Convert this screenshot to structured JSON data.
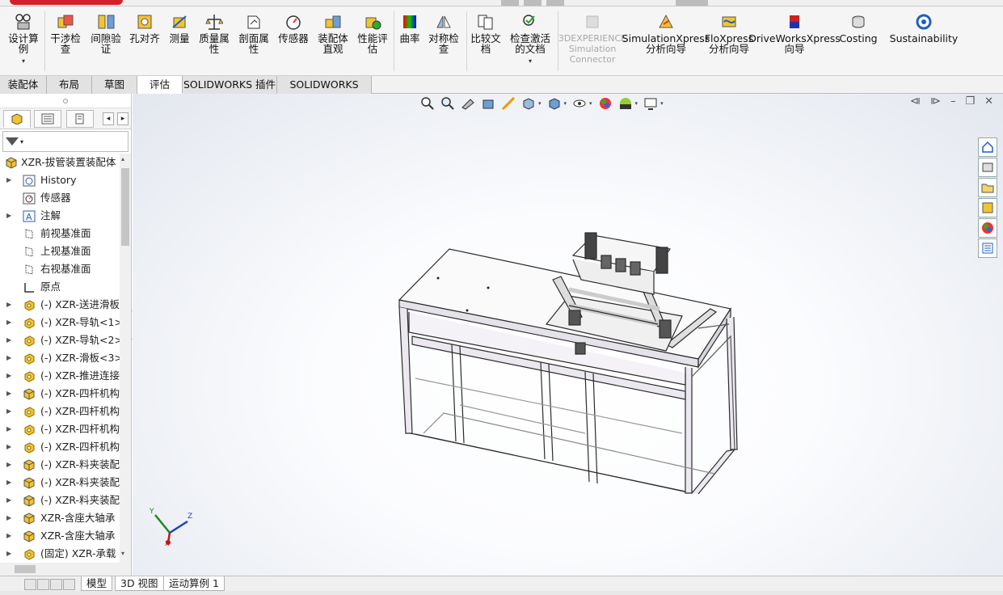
{
  "ribbon": {
    "buttons": [
      {
        "label": "设计算例",
        "dim": false
      },
      {
        "label": "干涉检查",
        "dim": false
      },
      {
        "label": "间隙验证",
        "dim": false
      },
      {
        "label": "孔对齐",
        "dim": false
      },
      {
        "label": "测量",
        "dim": false
      },
      {
        "label": "质量属性",
        "dim": false
      },
      {
        "label": "剖面属性",
        "dim": false
      },
      {
        "label": "传感器",
        "dim": false
      },
      {
        "label": "装配体直观",
        "dim": false
      },
      {
        "label": "性能评估",
        "dim": false
      },
      {
        "label": "曲率",
        "dim": false
      },
      {
        "label": "对称检查",
        "dim": false
      },
      {
        "label": "比较文档",
        "dim": false
      },
      {
        "label": "检查激活的文档",
        "dim": false
      },
      {
        "label": "3DEXPERIENCE Simulation Connector",
        "dim": true
      },
      {
        "label": "SimulationXpress 分析向导",
        "dim": false
      },
      {
        "label": "FloXpress 分析向导",
        "dim": false
      },
      {
        "label": "DriveWorksXpress 向导",
        "dim": false
      },
      {
        "label": "Costing",
        "dim": false
      },
      {
        "label": "Sustainability",
        "dim": false
      }
    ]
  },
  "command_tabs": [
    "装配体",
    "布局",
    "草图",
    "评估",
    "SOLIDWORKS 插件",
    "SOLIDWORKS MBD"
  ],
  "active_tab": "评估",
  "tree": {
    "root": "XZR-拔管装置装配体",
    "items": [
      {
        "label": "History",
        "expand": true,
        "icon": "history-icon"
      },
      {
        "label": "传感器",
        "expand": false,
        "icon": "sensor-icon"
      },
      {
        "label": "注解",
        "expand": true,
        "icon": "annotation-icon"
      },
      {
        "label": "前视基准面",
        "expand": false,
        "icon": "plane-icon"
      },
      {
        "label": "上视基准面",
        "expand": false,
        "icon": "plane-icon"
      },
      {
        "label": "右视基准面",
        "expand": false,
        "icon": "plane-icon"
      },
      {
        "label": "原点",
        "expand": false,
        "icon": "origin-icon"
      },
      {
        "label": "(-) XZR-送进滑板<",
        "expand": true,
        "icon": "part-icon"
      },
      {
        "label": "(-) XZR-导轨<1>",
        "expand": true,
        "icon": "part-icon"
      },
      {
        "label": "(-) XZR-导轨<2>",
        "expand": true,
        "icon": "part-icon"
      },
      {
        "label": "(-) XZR-滑板<3>",
        "expand": true,
        "icon": "part-icon"
      },
      {
        "label": "(-) XZR-推进连接",
        "expand": true,
        "icon": "part-icon"
      },
      {
        "label": "(-) XZR-四杆机构",
        "expand": true,
        "icon": "assembly-icon"
      },
      {
        "label": "(-) XZR-四杆机构",
        "expand": true,
        "icon": "part-icon"
      },
      {
        "label": "(-) XZR-四杆机构",
        "expand": true,
        "icon": "part-icon"
      },
      {
        "label": "(-) XZR-四杆机构",
        "expand": true,
        "icon": "part-icon"
      },
      {
        "label": "(-) XZR-料夹装配",
        "expand": true,
        "icon": "assembly-icon"
      },
      {
        "label": "(-) XZR-料夹装配",
        "expand": true,
        "icon": "assembly-icon"
      },
      {
        "label": "(-) XZR-料夹装配",
        "expand": true,
        "icon": "assembly-icon"
      },
      {
        "label": "XZR-含座大轴承",
        "expand": true,
        "icon": "assembly-icon"
      },
      {
        "label": "XZR-含座大轴承",
        "expand": true,
        "icon": "assembly-icon"
      },
      {
        "label": "(固定) XZR-承载",
        "expand": true,
        "icon": "part-icon"
      }
    ]
  },
  "bottom_tabs": [
    "模型",
    "3D 视图",
    "运动算例 1"
  ],
  "triad": {
    "x": "X",
    "y": "Y",
    "z": "Z"
  },
  "colors": {
    "accent": "#1f5fbf",
    "part_yellow": "#f4c430",
    "ribbon_bg": "#f5f5f5"
  }
}
